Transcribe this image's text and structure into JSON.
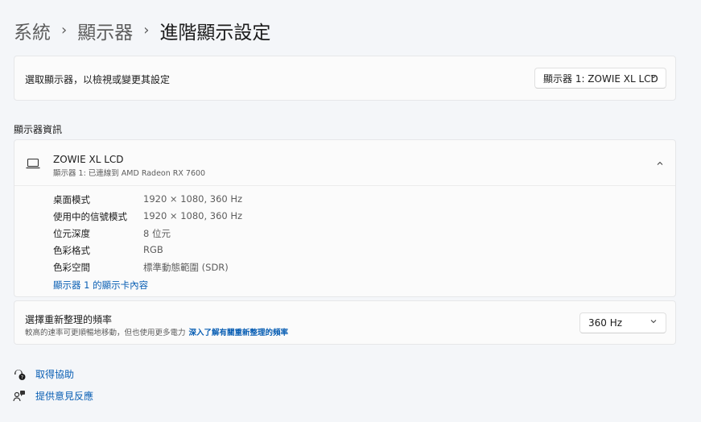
{
  "breadcrumb": {
    "items": [
      "系統",
      "顯示器"
    ],
    "current": "進階顯示設定",
    "separator": "›"
  },
  "display_select": {
    "label": "選取顯示器，以檢視或變更其設定",
    "selected": "顯示器 1: ZOWIE XL LCD"
  },
  "section_title": "顯示器資訊",
  "display_info": {
    "name": "ZOWIE XL LCD",
    "subtitle": "顯示器 1: 已連線到 AMD Radeon RX 7600",
    "properties": [
      {
        "key": "桌面模式",
        "value": "1920 × 1080, 360 Hz"
      },
      {
        "key": "使用中的信號模式",
        "value": "1920 × 1080, 360 Hz"
      },
      {
        "key": "位元深度",
        "value": "8 位元"
      },
      {
        "key": "色彩格式",
        "value": "RGB"
      },
      {
        "key": "色彩空間",
        "value": "標準動態範圍 (SDR)"
      }
    ],
    "adapter_link": "顯示器 1 的顯示卡內容"
  },
  "refresh_rate": {
    "title": "選擇重新整理的頻率",
    "description": "較高的速率可更順暢地移動，但也使用更多電力",
    "link": "深入了解有關重新整理的頻率",
    "selected": "360 Hz"
  },
  "footer": {
    "help": "取得協助",
    "feedback": "提供意見反應"
  },
  "icons": {
    "display": "laptop-icon",
    "expand": "chevron-up-icon",
    "dropdown": "chevron-down-icon",
    "help": "help-icon",
    "feedback": "feedback-icon"
  },
  "colors": {
    "background": "#f4f6f9",
    "card": "#fbfbfb",
    "link": "#0a5fb4",
    "secondary_text": "#5d5d5d"
  }
}
